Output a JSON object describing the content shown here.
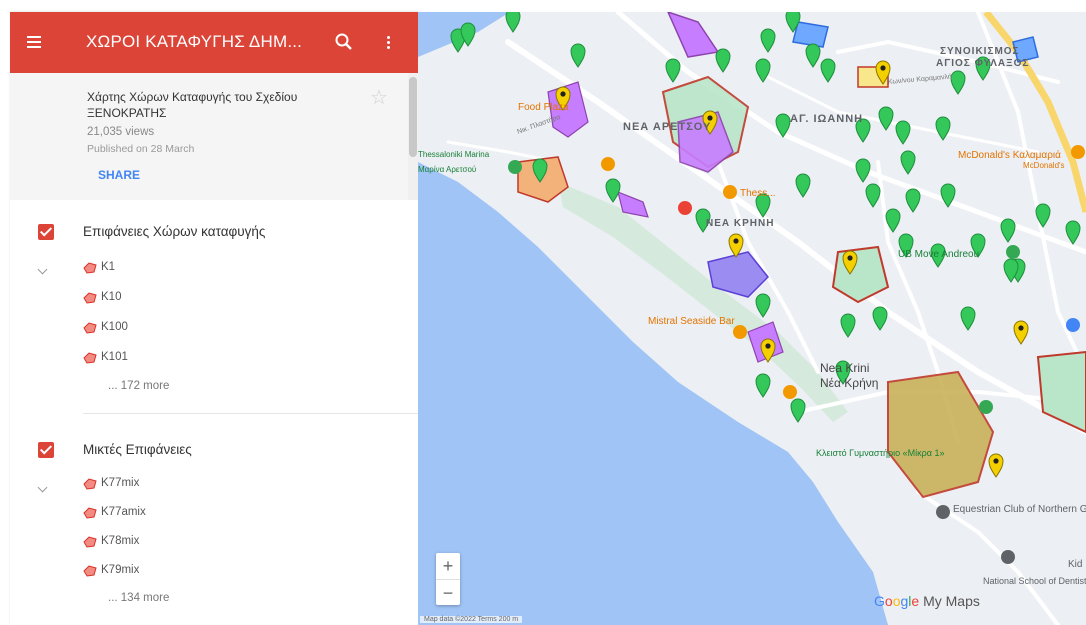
{
  "header": {
    "title": "ΧΩΡΟΙ ΚΑΤΑΦΥΓΗΣ ΔΗΜ..."
  },
  "info": {
    "description": "Χάρτης Χώρων Καταφυγής του Σχεδίου ΞΕΝΟΚΡΑΤΗΣ",
    "views": "21,035 views",
    "published": "Published on 28 March",
    "share_label": "SHARE"
  },
  "layers": [
    {
      "name": "Επιφάνειες Χώρων καταφυγής",
      "items": [
        "K1",
        "K10",
        "K100",
        "K101"
      ],
      "more": "... 172 more"
    },
    {
      "name": "Μικτές Επιφάνειες",
      "items": [
        "K77mix",
        "K77amix",
        "K78mix",
        "K79mix"
      ],
      "more": "... 134 more"
    }
  ],
  "map": {
    "labels": {
      "nea_aretsou": "ΝΕΑ ΑΡΕΤΣΟΥ",
      "ag_ioannis": "ΑΓ. ΙΩΑΝΝΗ",
      "synoikismos": "ΣΥΝΟΙΚΙΣΜΟΣ",
      "agios_fylaxos": "ΑΓΙΟΣ ΦΥΛΑΞΟΣ",
      "nea_krini_upper": "ΝΕΑ ΚΡΗΝΗ",
      "nea_krini_en": "Nea Krini",
      "nea_krini_gr": "Νέα Κρήνη",
      "food_plaza": "Food Plaza",
      "thess": "Thess...",
      "mcdonalds": "McDonald's Καλαμαριά",
      "mcdonalds_sub": "McDonald's",
      "marina": "Thessaloniki Marina",
      "marina_gr": "Μαρίνα Αρετσού",
      "ub_move": "UB Move Andreou",
      "mistral": "Mistral Seaside Bar",
      "kleisto": "Κλειστό Γυμναστήριο «Μίκρα 1»",
      "equestrian": "Equestrian Club of Northern Greece",
      "national_school": "National School of Dentistry",
      "kid": "Kid",
      "nik_plastira": "Νικ. Πλαστήρα",
      "konstantinou_karamanli": "Κων/νου Καραμανλή"
    },
    "zoom_in": "+",
    "zoom_out": "−",
    "brand_my_maps": "My Maps",
    "data_credit": "Map data ©2022   Terms   200 m"
  },
  "colors": {
    "header": "#db4437",
    "accent_blue": "#4285f4",
    "pin_green": "#34c759",
    "pin_yellow": "#f5d000",
    "water": "#9fc4f5"
  }
}
